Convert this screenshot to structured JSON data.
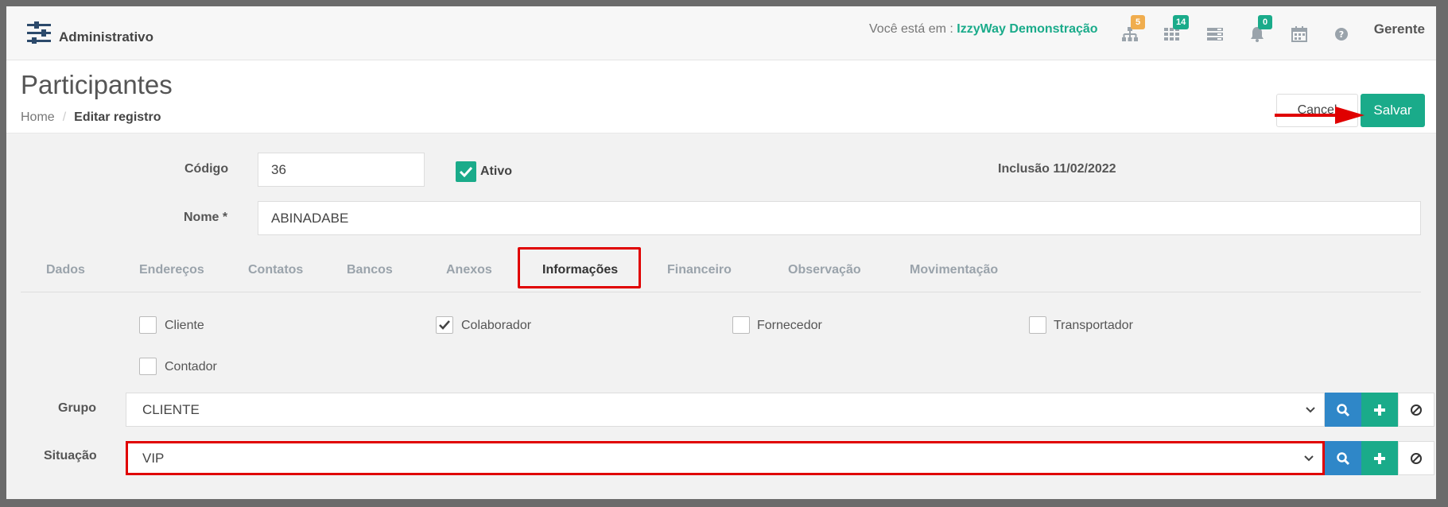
{
  "topbar": {
    "module_title": "Administrativo",
    "location_prefix": "Você está em :",
    "company": "IzzyWay Demonstração",
    "badges": {
      "org": "5",
      "grid": "14",
      "bell": "0"
    },
    "user": "Gerente"
  },
  "header": {
    "title": "Participantes",
    "breadcrumb": {
      "home": "Home",
      "sep": "/",
      "current": "Editar registro"
    },
    "cancel_label": "Cancel",
    "save_label": "Salvar"
  },
  "form": {
    "codigo_label": "Código",
    "codigo_value": "36",
    "ativo_label": "Ativo",
    "ativo_checked": true,
    "inclusao": "Inclusão 11/02/2022",
    "nome_label": "Nome *",
    "nome_value": "ABINADABE"
  },
  "tabs": [
    {
      "label": "Dados",
      "active": false
    },
    {
      "label": "Endereços",
      "active": false
    },
    {
      "label": "Contatos",
      "active": false
    },
    {
      "label": "Bancos",
      "active": false
    },
    {
      "label": "Anexos",
      "active": false
    },
    {
      "label": "Informações",
      "active": true
    },
    {
      "label": "Financeiro",
      "active": false
    },
    {
      "label": "Observação",
      "active": false
    },
    {
      "label": "Movimentação",
      "active": false
    }
  ],
  "informacoes": {
    "checkboxes": [
      {
        "label": "Cliente",
        "checked": false
      },
      {
        "label": "Colaborador",
        "checked": true
      },
      {
        "label": "Fornecedor",
        "checked": false
      },
      {
        "label": "Transportador",
        "checked": false
      },
      {
        "label": "Contador",
        "checked": false
      }
    ],
    "grupo_label": "Grupo",
    "grupo_value": "CLIENTE",
    "situacao_label": "Situação",
    "situacao_value": "VIP"
  },
  "colors": {
    "accent": "#1aab8a",
    "blue": "#2f87c8",
    "highlight": "#e00000",
    "badge_orange": "#f0ad4e"
  }
}
